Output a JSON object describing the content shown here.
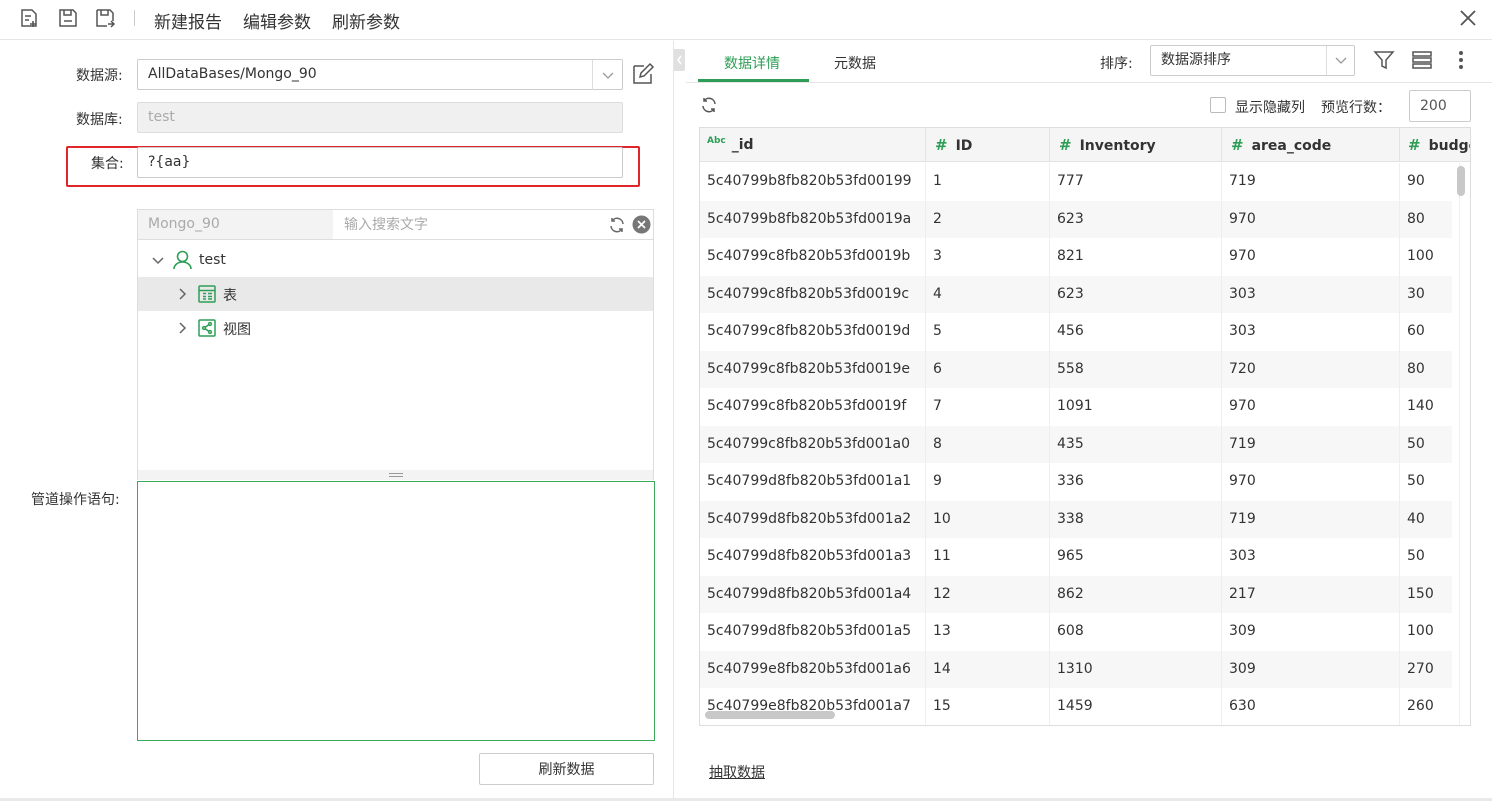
{
  "toolbar": {
    "new_report": "新建报告",
    "edit_params": "编辑参数",
    "refresh_params": "刷新参数"
  },
  "form": {
    "datasource_label": "数据源:",
    "datasource_value": "AllDataBases/Mongo_90",
    "database_label": "数据库:",
    "database_value": "test",
    "collection_label": "集合:",
    "collection_value": "?{aa}",
    "pipeline_label": "管道操作语句:",
    "refresh_data": "刷新数据"
  },
  "tree": {
    "db_name": "Mongo_90",
    "search_placeholder": "输入搜索文字",
    "root": "test",
    "items": [
      "表",
      "视图"
    ]
  },
  "right": {
    "tabs": [
      "数据详情",
      "元数据"
    ],
    "sort_label": "排序:",
    "sort_value": "数据源排序",
    "show_hidden": "显示隐藏列",
    "preview_label": "预览行数：",
    "preview_value": "200",
    "extract": "抽取数据"
  },
  "colors": {
    "accent": "#2e9e56",
    "highlight": "#e0262a"
  },
  "grid": {
    "type_abc": "Abc",
    "type_num": "#",
    "columns": [
      "_id",
      "ID",
      "Inventory",
      "area_code",
      "budget"
    ],
    "rows": [
      [
        "5c40799b8fb820b53fd00199",
        "1",
        "777",
        "719",
        "90"
      ],
      [
        "5c40799b8fb820b53fd0019a",
        "2",
        "623",
        "970",
        "80"
      ],
      [
        "5c40799c8fb820b53fd0019b",
        "3",
        "821",
        "970",
        "100"
      ],
      [
        "5c40799c8fb820b53fd0019c",
        "4",
        "623",
        "303",
        "30"
      ],
      [
        "5c40799c8fb820b53fd0019d",
        "5",
        "456",
        "303",
        "60"
      ],
      [
        "5c40799c8fb820b53fd0019e",
        "6",
        "558",
        "720",
        "80"
      ],
      [
        "5c40799c8fb820b53fd0019f",
        "7",
        "1091",
        "970",
        "140"
      ],
      [
        "5c40799c8fb820b53fd001a0",
        "8",
        "435",
        "719",
        "50"
      ],
      [
        "5c40799d8fb820b53fd001a1",
        "9",
        "336",
        "970",
        "50"
      ],
      [
        "5c40799d8fb820b53fd001a2",
        "10",
        "338",
        "719",
        "40"
      ],
      [
        "5c40799d8fb820b53fd001a3",
        "11",
        "965",
        "303",
        "50"
      ],
      [
        "5c40799d8fb820b53fd001a4",
        "12",
        "862",
        "217",
        "150"
      ],
      [
        "5c40799d8fb820b53fd001a5",
        "13",
        "608",
        "309",
        "100"
      ],
      [
        "5c40799e8fb820b53fd001a6",
        "14",
        "1310",
        "309",
        "270"
      ],
      [
        "5c40799e8fb820b53fd001a7",
        "15",
        "1459",
        "630",
        "260"
      ]
    ]
  }
}
